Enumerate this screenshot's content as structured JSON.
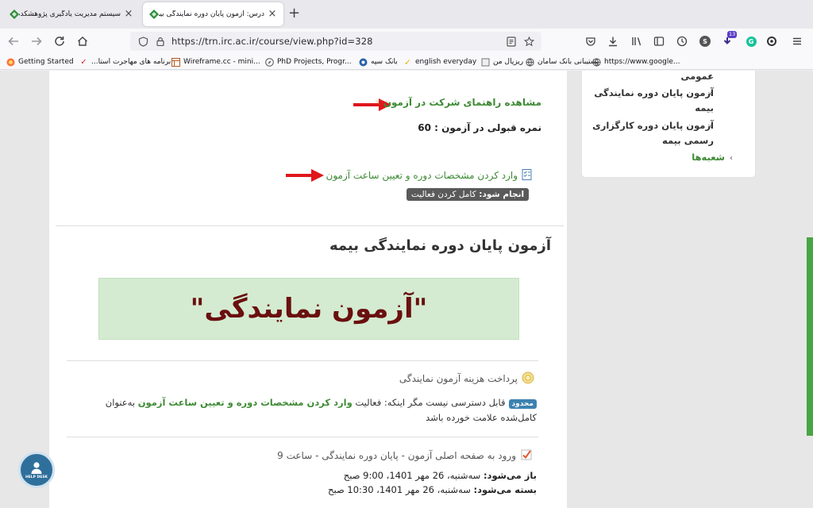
{
  "browser": {
    "tabs": [
      {
        "title": "سیستم مدیریت یادگیری پژوهشکده بیمه",
        "active": false
      },
      {
        "title": "درس: آزمون پایان دوره نمایندگی بیمه و ک",
        "active": true
      }
    ],
    "url": "https://trn.irc.ac.ir/course/view.php?id=328",
    "toolbar_badge_count": "13",
    "toolbar_avatar_letter": "S",
    "bookmarks": [
      {
        "label": "Getting Started",
        "icon": "firefox-icon"
      },
      {
        "label": "برنامه های مهاجرت استا...",
        "icon": "check-red-icon"
      },
      {
        "label": "Wireframe.cc - mini...",
        "icon": "wireframe-icon"
      },
      {
        "label": "PhD Projects, Progr...",
        "icon": "compass-icon"
      },
      {
        "label": "بانک سپه",
        "icon": "bank-icon"
      },
      {
        "label": "english everyday",
        "icon": "check-yellow-icon"
      },
      {
        "label": "ریزپال من",
        "icon": "box-icon"
      },
      {
        "label": "پشتیبانی بانک سامان",
        "icon": "globe-icon"
      },
      {
        "label": "https://www.google...",
        "icon": "globe-icon"
      }
    ]
  },
  "sidebar": {
    "items": [
      {
        "label": "عمومی"
      },
      {
        "label": "آزمون پایان دوره نمایندگی",
        "label2": "بیمه"
      },
      {
        "label": "آزمون پایان دوره کارگزاری",
        "label2": "رسمی بیمه"
      },
      {
        "label": "شعبه‌ها"
      }
    ]
  },
  "main": {
    "guide_link": "مشاهده راهنمای شرکت در آزمون",
    "pass_score": "نمره قبولی در آزمون : 60",
    "activity_link": "وارد کردن مشخصات دوره و تعیین ساعت آزمون",
    "completion_badge": {
      "label": "انجام شود:",
      "value": "کامل کردن فعالیت"
    },
    "section_title": "آزمون پایان دوره نمایندگی بیمه",
    "banner_text": "\"آزمون نمایندگی\"",
    "payment": {
      "title": "پرداخت هزینه آزمون نمایندگی",
      "tag": "محدود",
      "restriction_prefix": "قابل دسترسی نیست مگر اینکه: فعالیت",
      "restriction_link": "وارد کردن مشخصات دوره و تعیین ساعت آزمون",
      "restriction_suffix": "به‌عنوان",
      "restriction_line2": "کامل‌شده علامت خورده باشد"
    },
    "exam": {
      "title": "ورود به صفحه اصلی آزمون - پایان دوره نمایندگی - ساعت 9",
      "opens_label": "باز می‌شود:",
      "opens_value": "سه‌شنبه، 26 مهر 1401، 9:00 صبح",
      "closes_label": "بسته می‌شود:",
      "closes_value": "سه‌شنبه، 26 مهر 1401، 10:30 صبح"
    },
    "helpdesk_label": "HELP DESK"
  },
  "colors": {
    "accent_green": "#3d8a34",
    "arrow_red": "#e0161b",
    "banner_bg": "#d4ebd1",
    "banner_text": "#6a0f0f",
    "badge_gray": "#5a5a5a",
    "tag_blue": "#3c82b0"
  }
}
